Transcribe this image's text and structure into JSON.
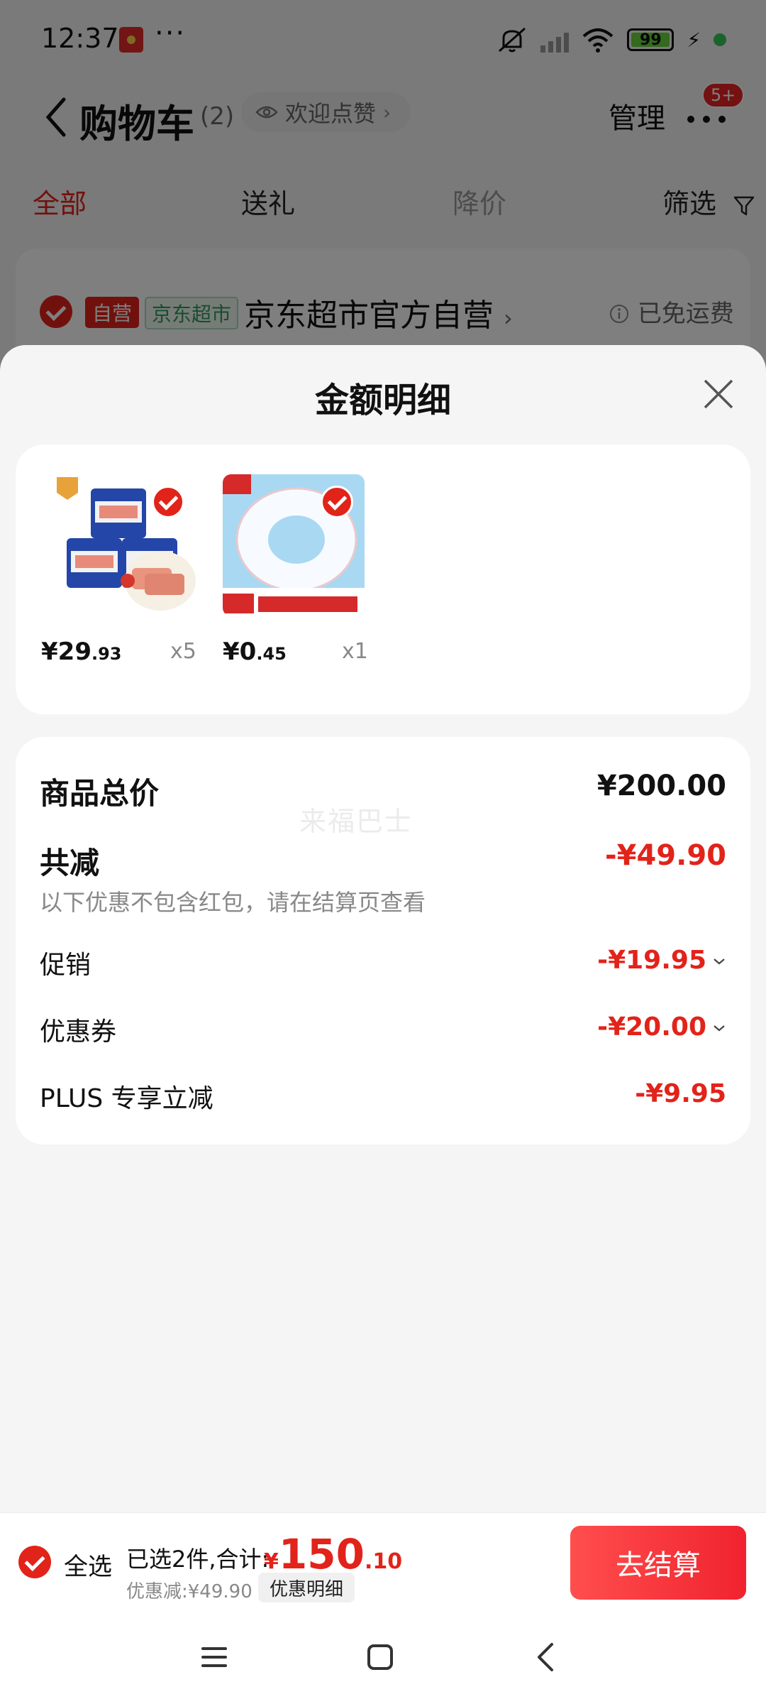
{
  "status_bar": {
    "time": "12:37",
    "dots": "···",
    "battery": "99"
  },
  "header": {
    "title": "购物车",
    "count": "(2)",
    "welcome": "欢迎点赞",
    "manage": "管理",
    "badge": "5+"
  },
  "tabs": [
    {
      "label": "全部"
    },
    {
      "label": "送礼"
    },
    {
      "label": "降价"
    },
    {
      "label": "筛选"
    }
  ],
  "store": {
    "tag_self": "自营",
    "tag_market": "京东超市",
    "name": "京东超市官方自营",
    "shipping": "已免运费"
  },
  "sheet": {
    "title": "金额明细",
    "products": [
      {
        "price_int": "¥29",
        "price_dec": ".93",
        "qty": "x5",
        "image": "luncheon-meat"
      },
      {
        "price_int": "¥0",
        "price_dec": ".45",
        "qty": "x1",
        "image": "tape-roll"
      }
    ],
    "summary": {
      "total_label": "商品总价",
      "total_value": "¥200.00",
      "watermark": "来福巴士",
      "reduce_label": "共减",
      "reduce_value": "-¥49.90",
      "note": "以下优惠不包含红包，请在结算页查看",
      "promo_label": "促销",
      "promo_value": "-¥19.95",
      "coupon_label": "优惠券",
      "coupon_value": "-¥20.00",
      "plus_label": "PLUS 专享立减",
      "plus_value": "-¥9.95"
    }
  },
  "bottom_bar": {
    "select_all": "全选",
    "selected": "已选2件,合计:",
    "currency": "¥",
    "total_int": "150",
    "total_dec": ".10",
    "discount": "优惠减:¥49.90",
    "detail_button": "优惠明细",
    "checkout_button": "去结算"
  },
  "colors": {
    "accent": "#e2231a",
    "checkout": "#f0232e",
    "overlay": "rgba(0,0,0,0.5)"
  },
  "icons": [
    "back-icon",
    "eye-icon",
    "more-icon",
    "filter-icon",
    "info-icon",
    "close-icon",
    "chevron-down-icon",
    "menu-icon",
    "home-icon",
    "nav-back-icon"
  ]
}
